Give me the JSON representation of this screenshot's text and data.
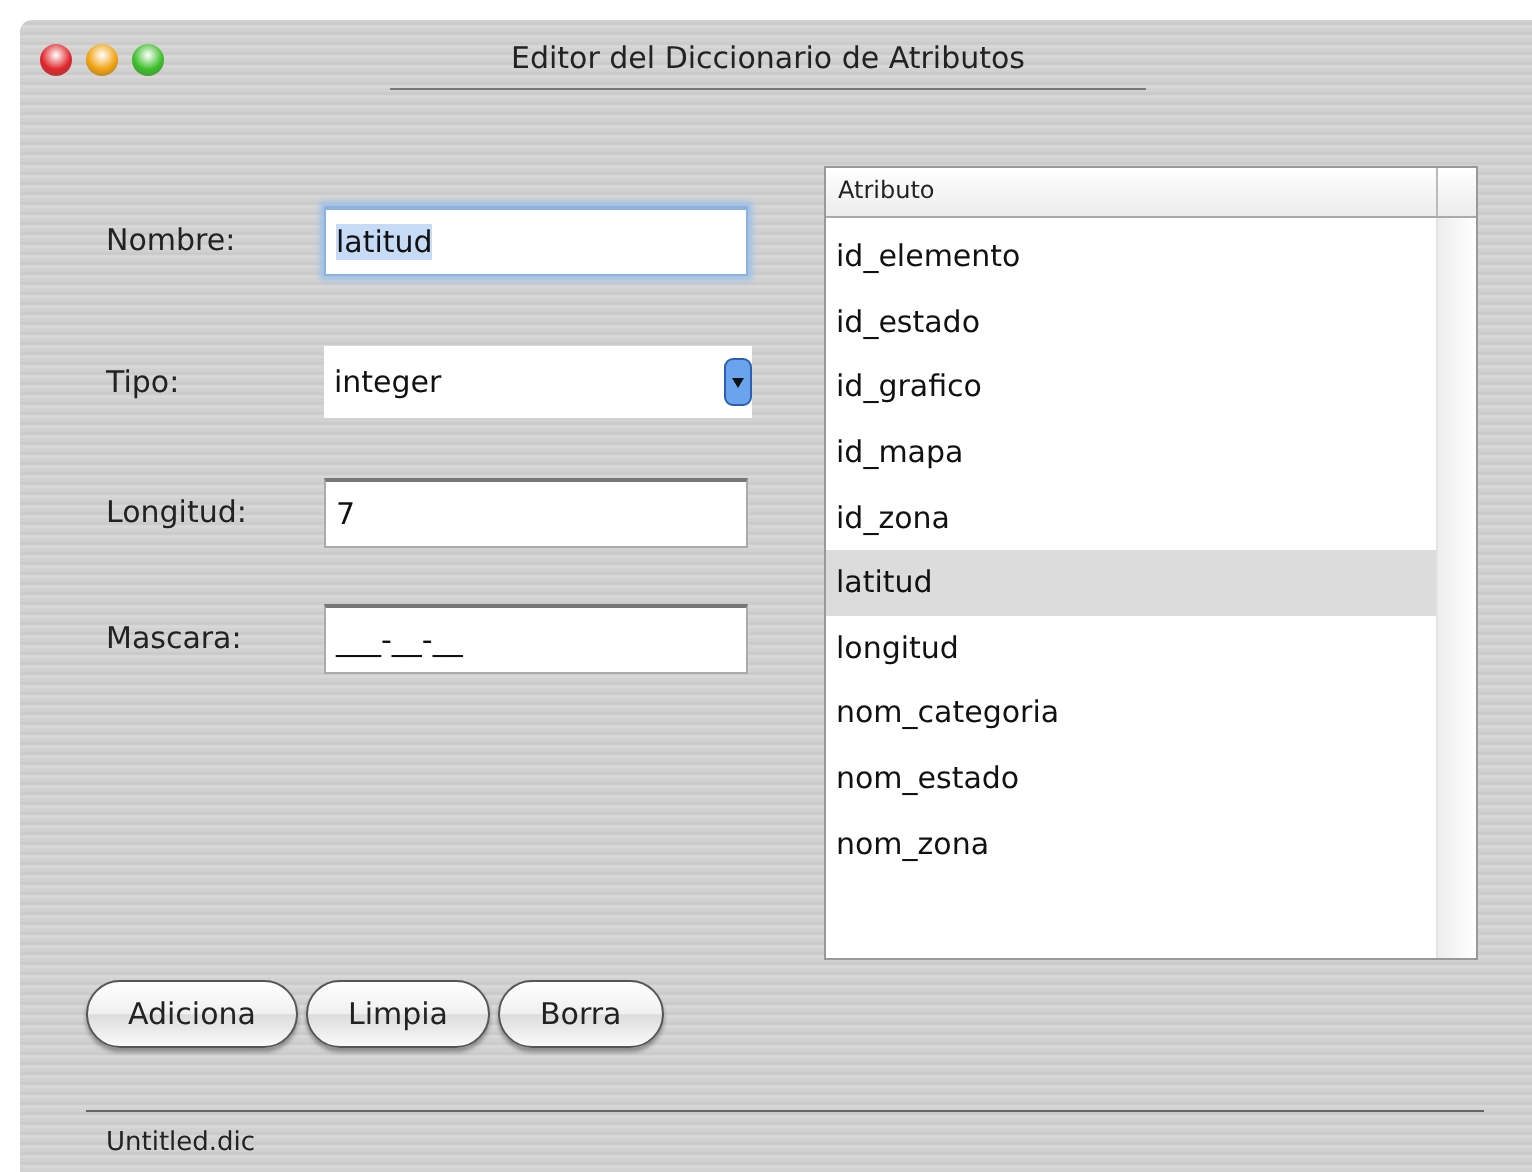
{
  "window": {
    "title": "Editor del Diccionario de Atributos"
  },
  "fields": [
    {
      "kind": "text",
      "label": "Nombre:",
      "value": "latitud",
      "focused": true
    },
    {
      "kind": "select",
      "label": "Tipo:",
      "value": "integer"
    },
    {
      "kind": "text",
      "label": "Longitud:",
      "value": "7",
      "focused": false
    },
    {
      "kind": "text",
      "label": "Mascara:",
      "value": "___-__-__",
      "focused": false
    }
  ],
  "buttons": [
    "Adiciona",
    "Limpia",
    "Borra"
  ],
  "list": {
    "column": "Atributo",
    "items": [
      {
        "label": "id_elemento",
        "selected": false
      },
      {
        "label": "id_estado",
        "selected": false
      },
      {
        "label": "id_grafico",
        "selected": false
      },
      {
        "label": "id_mapa",
        "selected": false
      },
      {
        "label": "id_zona",
        "selected": false
      },
      {
        "label": "latitud",
        "selected": true
      },
      {
        "label": "longitud",
        "selected": false
      },
      {
        "label": "nom_categoria",
        "selected": false
      },
      {
        "label": "nom_estado",
        "selected": false
      },
      {
        "label": "nom_zona",
        "selected": false
      }
    ]
  },
  "status_bar": {
    "file": "Untitled.dic"
  }
}
